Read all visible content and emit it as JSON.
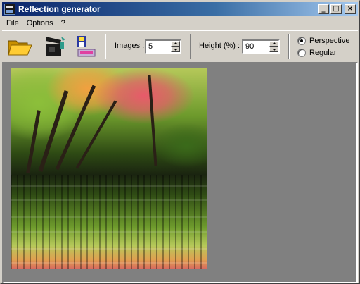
{
  "window": {
    "title": "Reflection generator",
    "controls": {
      "minimize": "_",
      "maximize": "□",
      "close": "×"
    }
  },
  "menu": {
    "items": [
      "File",
      "Options",
      "?"
    ]
  },
  "toolbar": {
    "open_icon": "folder-open-icon",
    "camera_icon": "reflection-camera-icon",
    "save_icon": "save-disk-icon",
    "images_label": "Images :",
    "images_value": "5",
    "height_label": "Height (%) :",
    "height_value": "90",
    "mode_options": [
      "Perspective",
      "Regular"
    ],
    "mode_selected": "Perspective"
  },
  "canvas": {
    "background_color": "#808080",
    "image": "autumn-forest-with-water-reflection"
  }
}
